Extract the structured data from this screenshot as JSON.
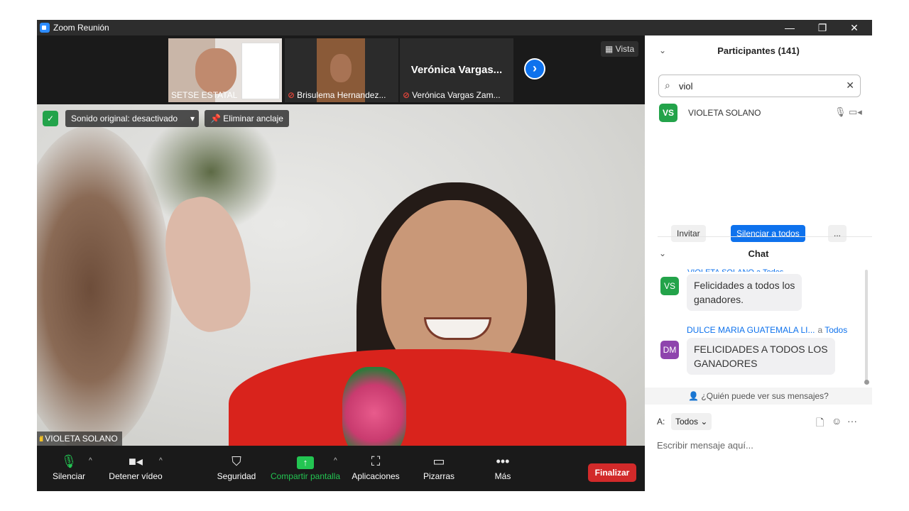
{
  "window": {
    "title": "Zoom Reunión"
  },
  "window_controls": {
    "minimize": "—",
    "restore": "❐",
    "close": "✕"
  },
  "strip": {
    "thumbnails": [
      {
        "label": "SETSE ESTATAL",
        "muted": false
      },
      {
        "label": "Brisulema Hernandez...",
        "muted": true
      },
      {
        "label": "Verónica Vargas Zam...",
        "muted": true,
        "center_name": "Verónica  Vargas..."
      }
    ],
    "next_glyph": "›",
    "view_label": "Vista"
  },
  "main_video": {
    "original_sound": "Sonido original: desactivado",
    "unpin": "Eliminar anclaje",
    "speaker_name": "VIOLETA SOLANO"
  },
  "toolbar": {
    "mute": "Silenciar",
    "stop_video": "Detener vídeo",
    "security": "Seguridad",
    "share": "Compartir pantalla",
    "apps": "Aplicaciones",
    "whiteboards": "Pizarras",
    "more": "Más",
    "end": "Finalizar"
  },
  "participants": {
    "title": "Participantes (141)",
    "search_value": "viol",
    "list": [
      {
        "initials": "VS",
        "name": "VIOLETA SOLANO",
        "avatar_color": "#23a34a"
      }
    ],
    "invite": "Invitar",
    "mute_all": "Silenciar a todos",
    "more": "..."
  },
  "chat": {
    "title": "Chat",
    "cut_sender": "VIOLETA SOLANO a Todos",
    "messages": [
      {
        "initials": "VS",
        "avatar_color": "#23a34a",
        "lines": [
          "Felicidades a todos los",
          "ganadores."
        ]
      },
      {
        "sender": "DULCE MARIA GUATEMALA LI...",
        "to_prefix": "a",
        "to": "Todos",
        "initials": "DM",
        "avatar_color": "#8e44ad",
        "lines": [
          "FELICIDADES A TODOS LOS",
          "GANADORES"
        ]
      }
    ],
    "who_can_see": "¿Quién puede ver sus mensajes?",
    "to_label": "A:",
    "to_select": "Todos",
    "compose_placeholder": "Escribir mensaje aquí..."
  },
  "colors": {
    "accent": "#0e72ed",
    "end_red": "#d22a2a",
    "share_green": "#23c552"
  }
}
